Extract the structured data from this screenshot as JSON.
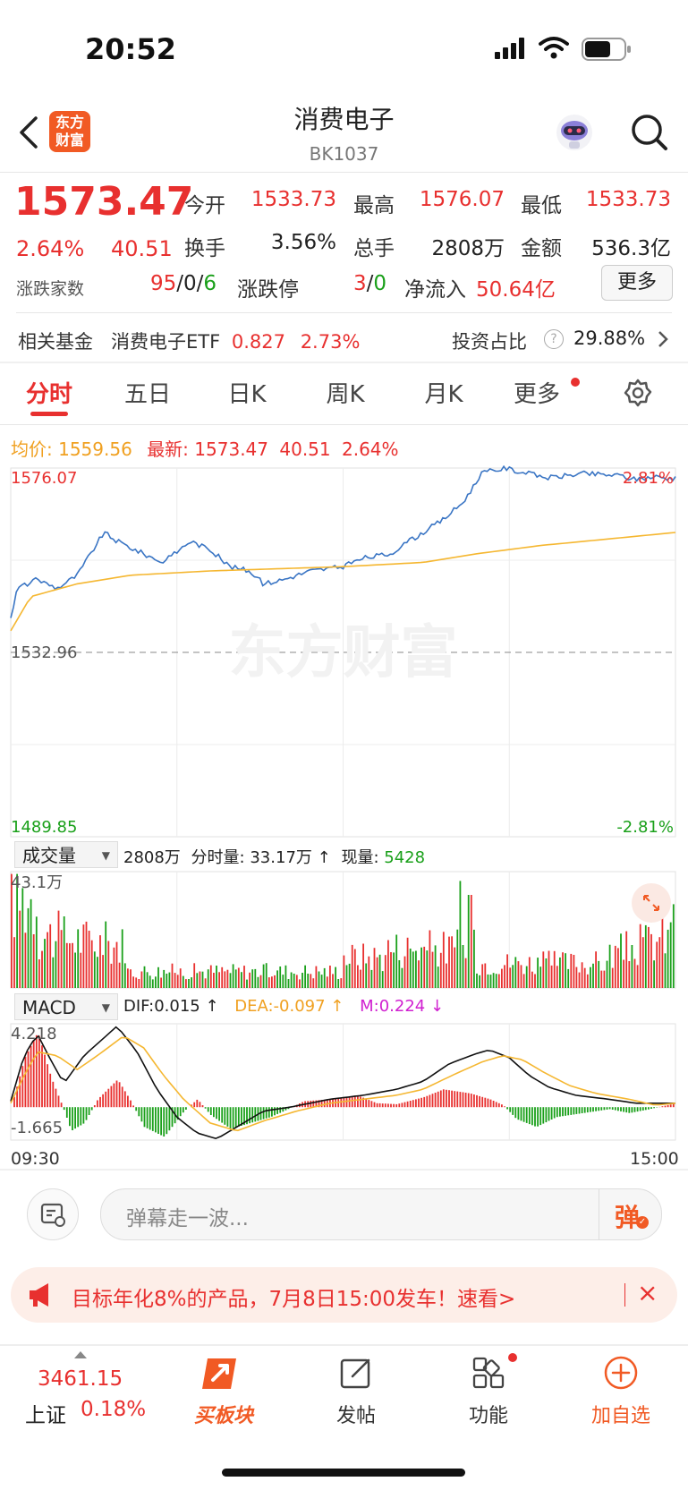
{
  "status_bar": {
    "time": "20:52"
  },
  "header": {
    "title": "消费电子",
    "code": "BK1037"
  },
  "quote": {
    "price": "1573.47",
    "change_pct": "2.64%",
    "change_abs": "40.51",
    "open_label": "今开",
    "open": "1533.73",
    "high_label": "最高",
    "high": "1576.07",
    "low_label": "最低",
    "low": "1533.73",
    "turnover_label": "换手",
    "turnover": "3.56%",
    "volume_label": "总手",
    "volume": "2808万",
    "amount_label": "金额",
    "amount": "536.3亿",
    "breadth_label": "涨跌家数",
    "up": "95",
    "flat": "0",
    "down": "6",
    "slash": "/",
    "limit_label": "涨跌停",
    "limit_up": "3",
    "limit_down": "0",
    "netflow_label": "净流入",
    "netflow": "50.64亿",
    "more_label": "更多"
  },
  "fund": {
    "label": "相关基金",
    "name": "消费电子ETF",
    "price": "0.827",
    "change": "2.73%",
    "ratio_label": "投资占比",
    "ratio": "29.88%"
  },
  "tabs": [
    "分时",
    "五日",
    "日K",
    "周K",
    "月K",
    "更多"
  ],
  "intraday": {
    "avg_label": "均价:",
    "avg": "1559.56",
    "latest_label": "最新:",
    "latest": "1573.47",
    "latest_change": "40.51",
    "latest_pct": "2.64%",
    "y_top": "1576.07",
    "y_mid": "1532.96",
    "y_bottom": "1489.85",
    "pct_top": "2.81%",
    "pct_bottom": "-2.81%",
    "watermark": "东方财富"
  },
  "volume_panel": {
    "selector": "成交量",
    "total": "2808万",
    "minute_label": "分时量:",
    "minute": "33.17万",
    "arrow": "↑",
    "current_label": "现量:",
    "current": "5428",
    "max_label": "43.1万"
  },
  "macd_panel": {
    "selector": "MACD",
    "dif": "DIF:0.015 ↑",
    "dea": "DEA:-0.097 ↑",
    "m": "M:0.224 ↓",
    "top": "4.218",
    "bottom": "-1.665"
  },
  "time_axis": {
    "start": "09:30",
    "end": "15:00"
  },
  "barrage": {
    "placeholder": "弹幕走一波...",
    "button": "弹"
  },
  "ad": {
    "text": "目标年化8%的产品，7月8日15:00发车！速看>"
  },
  "bottom_nav": {
    "index_value": "3461.15",
    "index_name": "上证",
    "index_change": "0.18%",
    "items": [
      "买板块",
      "发帖",
      "功能",
      "加自选"
    ]
  },
  "colors": {
    "up": "#e8302f",
    "down": "#1aa01a",
    "avg_line": "#f5b731",
    "price_line": "#3a75c4",
    "accent": "#f15a24"
  }
}
